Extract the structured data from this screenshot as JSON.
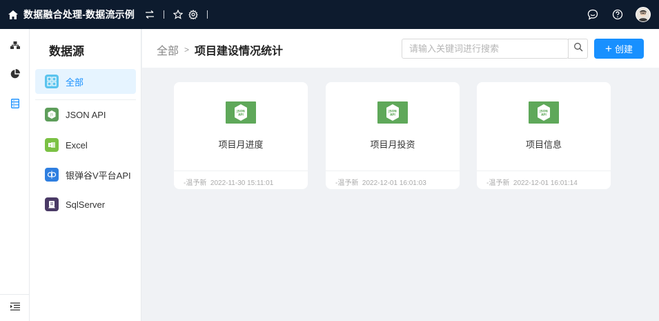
{
  "topbar": {
    "title": "数据融合处理-数据流示例"
  },
  "panel": {
    "title": "数据源",
    "items": [
      {
        "label": "全部",
        "icon": "grid-icon",
        "color": "#5bc4ee",
        "active": true
      },
      {
        "label": "JSON API",
        "icon": "json-api-icon",
        "color": "#5e9e5b"
      },
      {
        "label": "Excel",
        "icon": "excel-icon",
        "color": "#7bc144"
      },
      {
        "label": "银弹谷V平台API",
        "icon": "api-platform-icon",
        "color": "#2f7fe0"
      },
      {
        "label": "SqlServer",
        "icon": "sqlserver-icon",
        "color": "#4a3a66"
      }
    ]
  },
  "header": {
    "crumb_root": "全部",
    "crumb_sep": ">",
    "crumb_current": "项目建设情况统计",
    "search_placeholder": "请输入关键词进行搜索",
    "create_label": "创建"
  },
  "cards": [
    {
      "name": "项目月进度",
      "author": "-温予新",
      "time": "2022-11-30 15:11:01"
    },
    {
      "name": "项目月投资",
      "author": "-温予新",
      "time": "2022-12-01 16:01:03"
    },
    {
      "name": "项目信息",
      "author": "-温予新",
      "time": "2022-12-01 16:01:14"
    }
  ],
  "colors": {
    "topbar": "#0d1b2e",
    "accent": "#1890ff",
    "json_green": "#5fa85a"
  }
}
